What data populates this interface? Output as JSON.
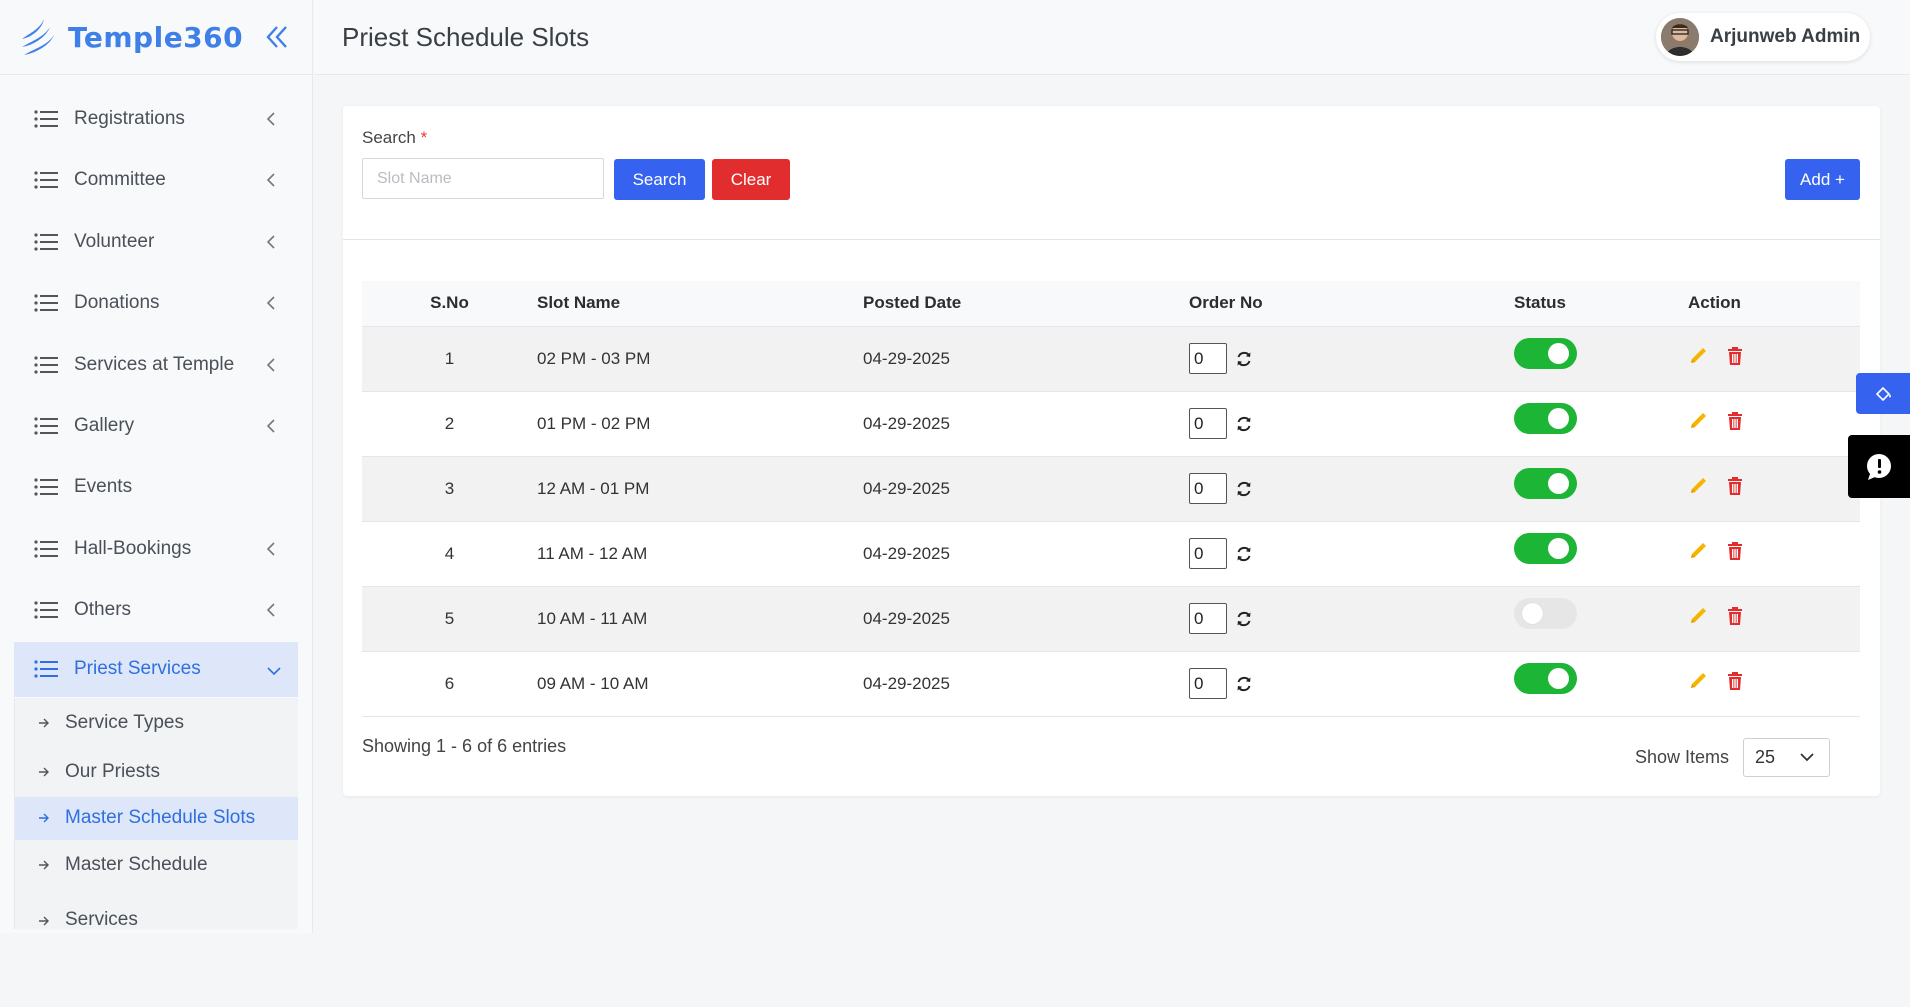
{
  "brand": {
    "name": "Temple360"
  },
  "header": {
    "title": "Priest Schedule Slots",
    "user_name": "Arjunweb Admin"
  },
  "sidebar": {
    "items": [
      {
        "label": "Registrations"
      },
      {
        "label": "Committee"
      },
      {
        "label": "Volunteer"
      },
      {
        "label": "Donations"
      },
      {
        "label": "Services at Temple"
      },
      {
        "label": "Gallery"
      },
      {
        "label": "Events"
      },
      {
        "label": "Hall-Bookings"
      },
      {
        "label": "Others"
      },
      {
        "label": "Priest Services"
      }
    ],
    "submenu": [
      {
        "label": "Service Types"
      },
      {
        "label": "Our Priests"
      },
      {
        "label": "Master Schedule Slots"
      },
      {
        "label": "Master Schedule"
      },
      {
        "label": "Services"
      }
    ]
  },
  "search": {
    "label": "Search",
    "required_mark": "*",
    "placeholder": "Slot Name",
    "value": "",
    "search_label": "Search",
    "clear_label": "Clear",
    "add_label": "Add +"
  },
  "table": {
    "columns": [
      "S.No",
      "Slot Name",
      "Posted Date",
      "Order No",
      "Status",
      "Action"
    ],
    "rows": [
      {
        "sno": "1",
        "slot": "02 PM - 03 PM",
        "date": "04-29-2025",
        "order": "0",
        "status": "on"
      },
      {
        "sno": "2",
        "slot": "01 PM - 02 PM",
        "date": "04-29-2025",
        "order": "0",
        "status": "on"
      },
      {
        "sno": "3",
        "slot": "12 AM - 01 PM",
        "date": "04-29-2025",
        "order": "0",
        "status": "on"
      },
      {
        "sno": "4",
        "slot": "11 AM - 12 AM",
        "date": "04-29-2025",
        "order": "0",
        "status": "on"
      },
      {
        "sno": "5",
        "slot": "10 AM - 11 AM",
        "date": "04-29-2025",
        "order": "0",
        "status": "off"
      },
      {
        "sno": "6",
        "slot": "09 AM - 10 AM",
        "date": "04-29-2025",
        "order": "0",
        "status": "on"
      }
    ]
  },
  "footer": {
    "entries_text": "Showing 1 - 6 of 6 entries",
    "show_items_label": "Show Items",
    "page_size": "25"
  },
  "icons": {
    "edit": "pencil-icon",
    "delete": "trash-icon",
    "refresh": "refresh-icon",
    "nav": "list-icon"
  },
  "colors": {
    "primary": "#3563f0",
    "danger": "#e12d2d",
    "success": "#1db535",
    "active_bg": "#dde7f9",
    "active_text": "#2f6fe0"
  }
}
